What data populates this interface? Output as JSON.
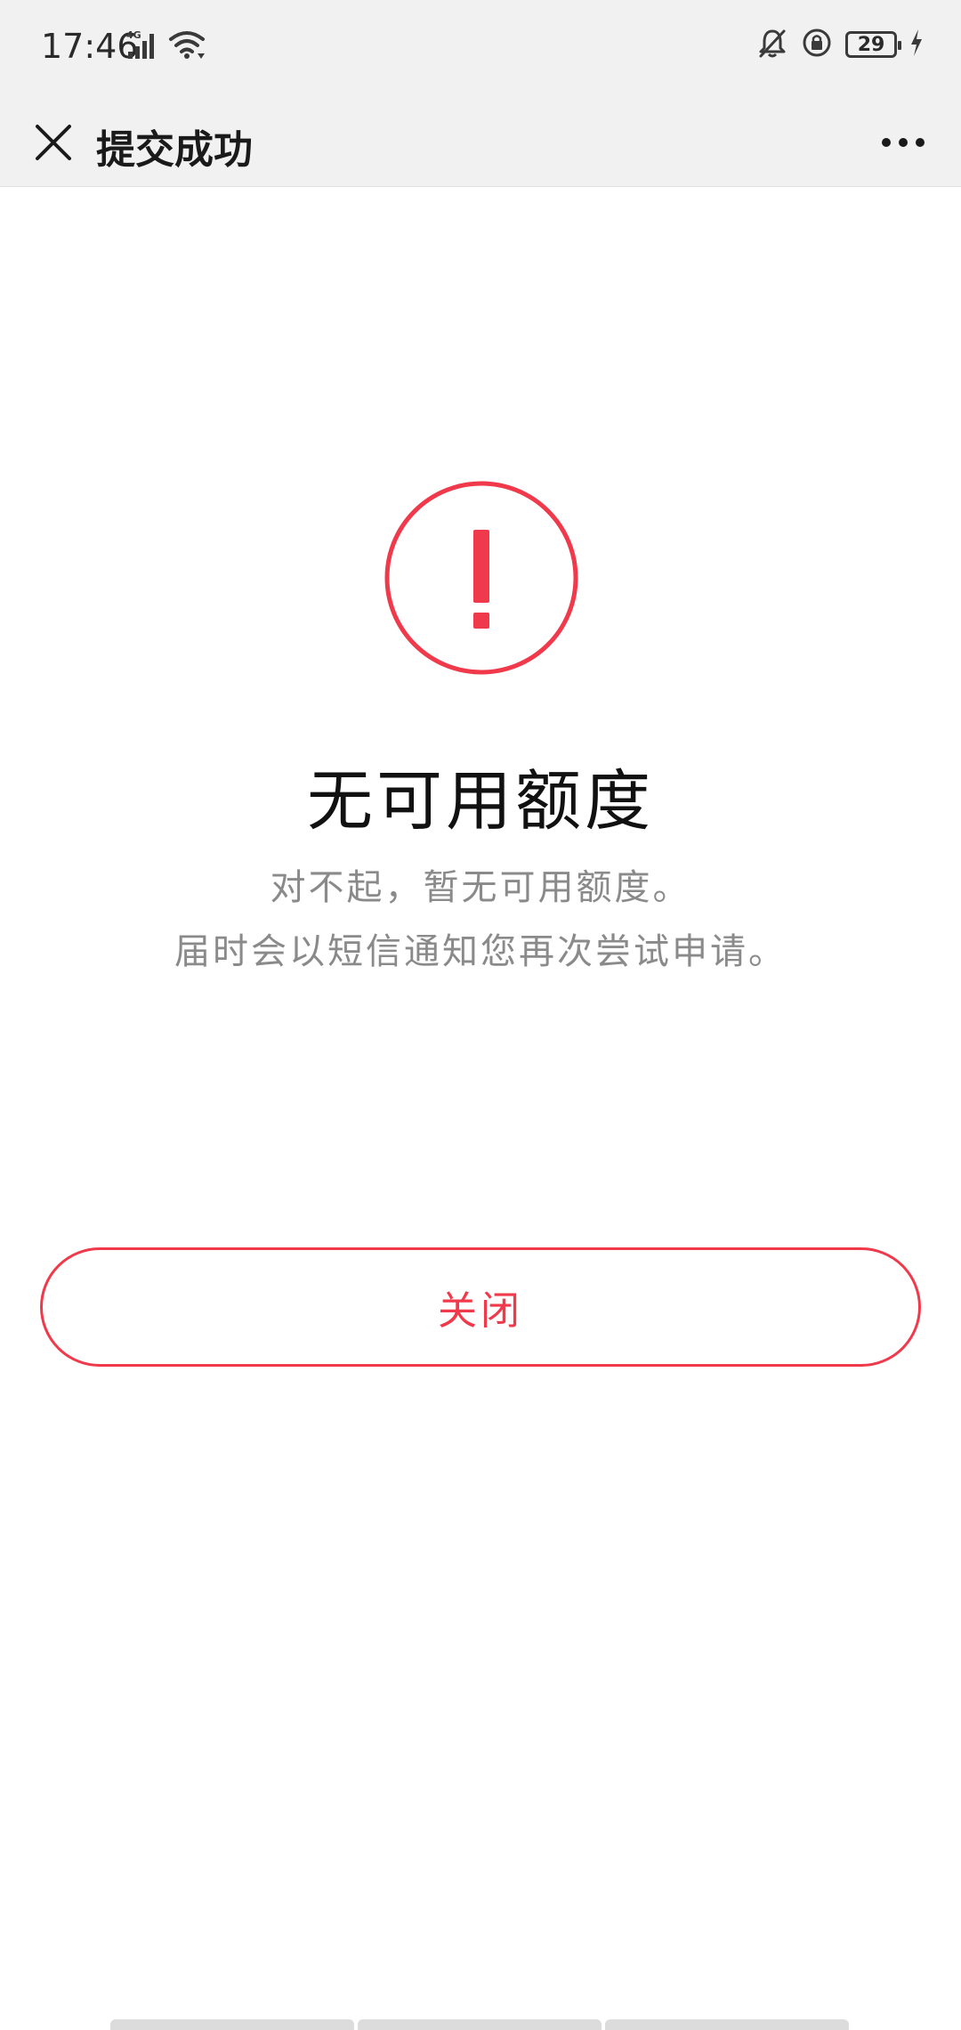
{
  "status_bar": {
    "time": "17:46",
    "network_label": "4G",
    "battery_level": "29",
    "icons": [
      "signal-icon",
      "wifi-icon",
      "mute-bell-icon",
      "rotation-lock-icon",
      "battery-icon",
      "charging-icon"
    ]
  },
  "nav_bar": {
    "title": "提交成功",
    "close_icon": "close-icon",
    "more_icon": "more-icon"
  },
  "result": {
    "icon": "warning-icon",
    "title": "无可用额度",
    "description_line1": "对不起，暂无可用额度。",
    "description_line2": "届时会以短信通知您再次尝试申请。"
  },
  "actions": {
    "close_label": "关闭"
  },
  "colors": {
    "accent": "#f0394a",
    "bar_background": "#f1f1f1",
    "secondary_text": "#8a8a8a"
  }
}
